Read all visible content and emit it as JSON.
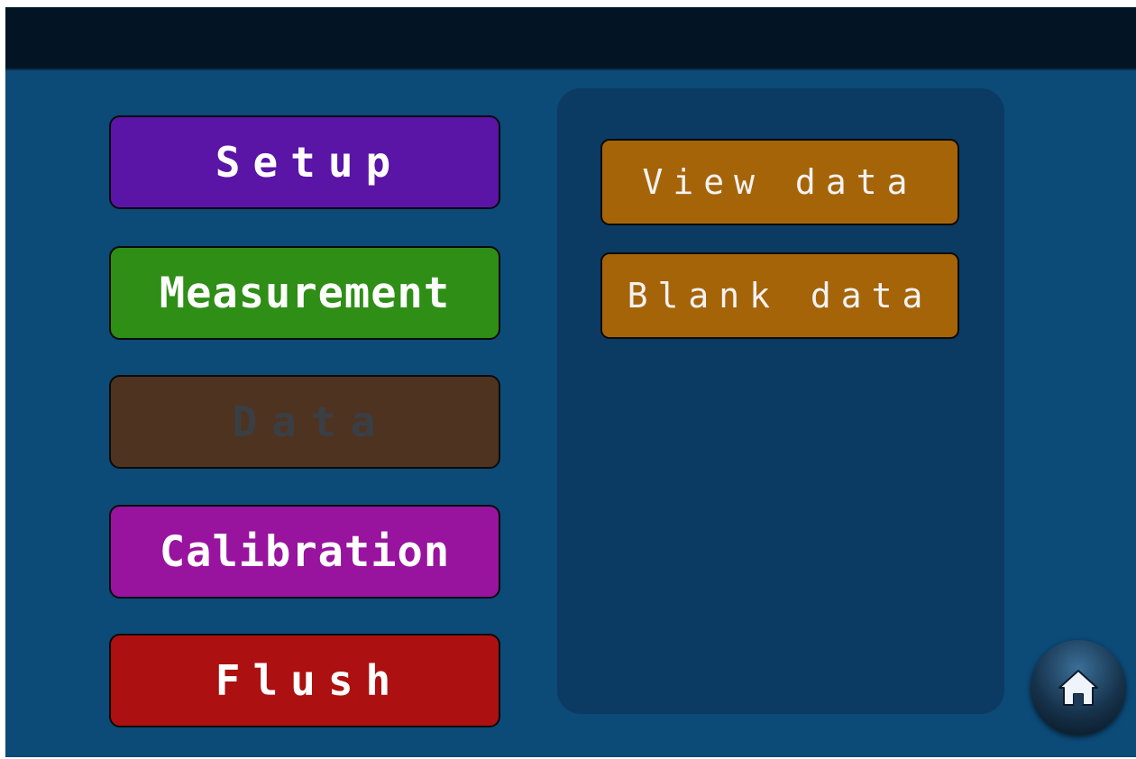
{
  "main_menu": {
    "setup_label": "Setup",
    "measurement_label": "Measurement",
    "data_label": "Data",
    "calibration_label": "Calibration",
    "flush_label": "Flush"
  },
  "data_submenu": {
    "view_data_label": "View data",
    "blank_data_label": "Blank data"
  },
  "home_button": {
    "icon": "home-icon"
  },
  "colors": {
    "background": "#0c4a78",
    "top_bar": "#031525",
    "setup": "#5a14a6",
    "measurement": "#2e8e16",
    "data_selected": "#4e3320",
    "calibration": "#98139e",
    "flush": "#ac1010",
    "submenu_button": "#a66409"
  }
}
